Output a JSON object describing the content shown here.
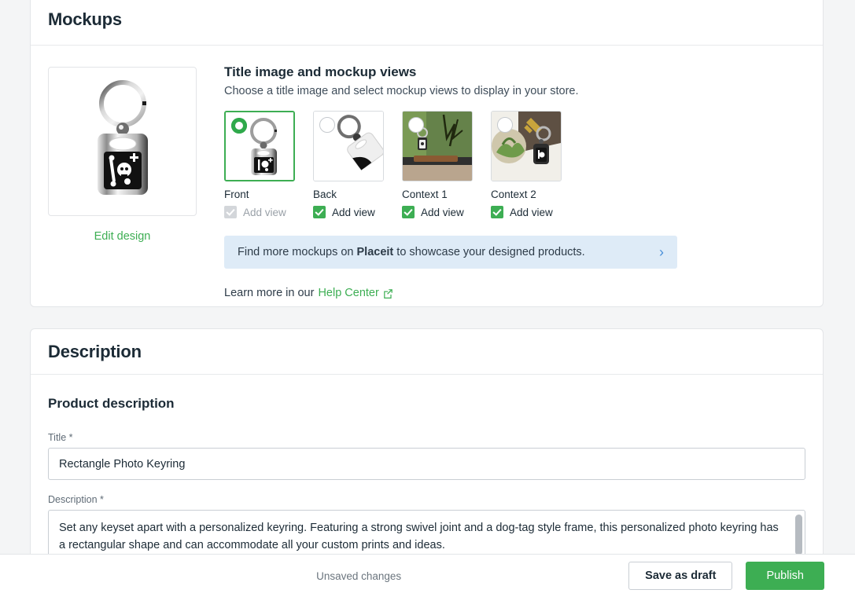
{
  "mockups": {
    "card_title": "Mockups",
    "design": {
      "edit_label": "Edit design",
      "alt": "rectangle photo keyring with skull design"
    },
    "views_heading": "Title image and mockup views",
    "views_subtitle": "Choose a title image and select mockup views to display in your store.",
    "thumbnails": [
      {
        "label": "Front",
        "checkbox_label": "Add view",
        "selected": true,
        "checked": true,
        "checkbox_disabled": true
      },
      {
        "label": "Back",
        "checkbox_label": "Add view",
        "selected": false,
        "checked": true,
        "checkbox_disabled": false
      },
      {
        "label": "Context 1",
        "checkbox_label": "Add view",
        "selected": false,
        "checked": true,
        "checkbox_disabled": false
      },
      {
        "label": "Context 2",
        "checkbox_label": "Add view",
        "selected": false,
        "checked": true,
        "checkbox_disabled": false
      }
    ],
    "banner": {
      "text_before": "Find more mockups on ",
      "brand": "Placeit",
      "text_after": " to showcase your designed products.",
      "chevron": "›",
      "background": "#deebf7",
      "chevron_color": "#4a90d9"
    },
    "learn_more": {
      "prefix": "Learn more in our ",
      "link_label": "Help Center",
      "icon": "external-link-icon"
    }
  },
  "description": {
    "card_title": "Description",
    "section_heading": "Product description",
    "title_field": {
      "label": "Title *",
      "value": "Rectangle Photo Keyring",
      "placeholder": "Title"
    },
    "description_field": {
      "label": "Description *",
      "value": "Set any keyset apart with a personalized keyring. Featuring a strong swivel joint and a dog-tag style frame, this personalized photo keyring has a rectangular shape and can accommodate all your custom prints and ideas.",
      "placeholder": "Description"
    }
  },
  "footer": {
    "status": "Unsaved changes",
    "save_draft_label": "Save as draft",
    "publish_label": "Publish"
  },
  "colors": {
    "accent_green": "#3dae53",
    "radio_green": "#2fa94b",
    "page_background": "#f4f5f6",
    "card_background": "#ffffff",
    "border": "#e3e5e8",
    "text_primary": "#1c2b36",
    "text_muted": "#6b757e"
  }
}
